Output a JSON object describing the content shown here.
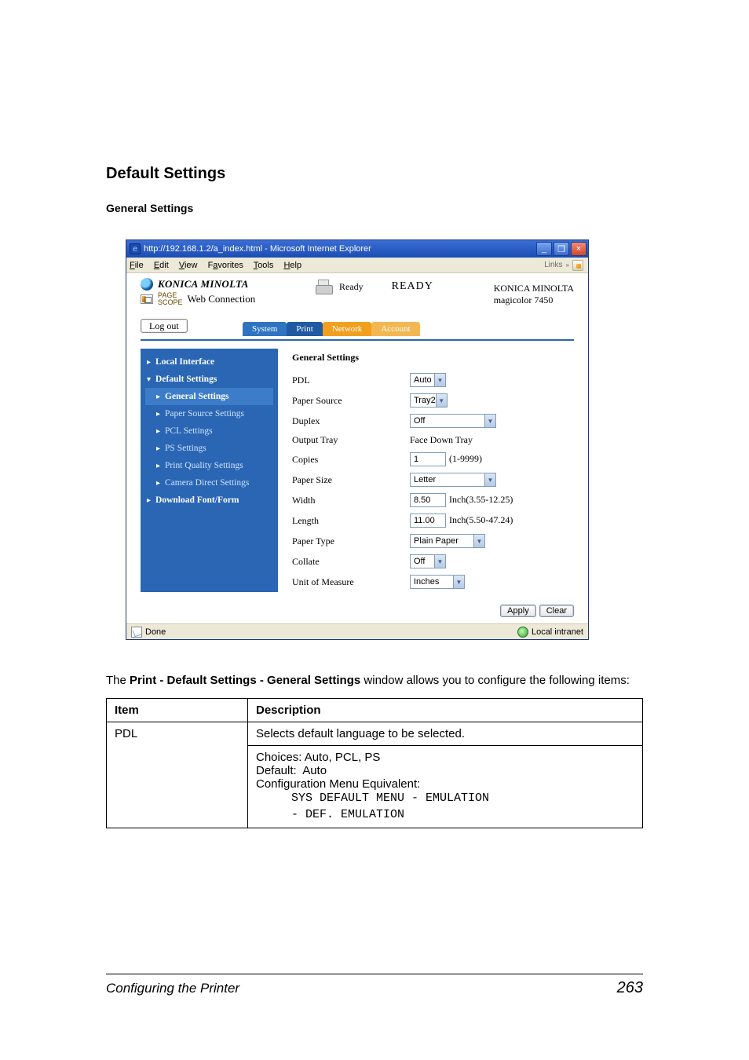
{
  "headings": {
    "h2": "Default Settings",
    "h3": "General Settings"
  },
  "ie": {
    "title": "http://192.168.1.2/a_index.html - Microsoft Internet Explorer",
    "menu": {
      "file": "File",
      "edit": "Edit",
      "view": "View",
      "favorites": "Favorites",
      "tools": "Tools",
      "help": "Help"
    },
    "links_label": "Links",
    "status_done": "Done",
    "status_zone": "Local intranet"
  },
  "app": {
    "brand": "KONICA MINOLTA",
    "pws_small": "PAGE\nSCOPE",
    "pws_main": "Web Connection",
    "ready_small": "Ready",
    "ready_big": "READY",
    "brand_right1": "KONICA MINOLTA",
    "brand_right2": "magicolor 7450",
    "logout": "Log out",
    "tabs": {
      "system": "System",
      "print": "Print",
      "network": "Network",
      "account": "Account"
    }
  },
  "nav": {
    "local_interface": "Local Interface",
    "default_settings": "Default Settings",
    "general_settings": "General Settings",
    "paper_source_settings": "Paper Source Settings",
    "pcl_settings": "PCL Settings",
    "ps_settings": "PS Settings",
    "print_quality_settings": "Print Quality Settings",
    "camera_direct_settings": "Camera Direct Settings",
    "download_font_form": "Download Font/Form"
  },
  "pane": {
    "title": "General Settings",
    "rows": {
      "pdl": {
        "label": "PDL",
        "value": "Auto"
      },
      "source": {
        "label": "Paper Source",
        "value": "Tray2"
      },
      "duplex": {
        "label": "Duplex",
        "value": "Off"
      },
      "out_tray": {
        "label": "Output Tray",
        "value": "Face Down Tray"
      },
      "copies": {
        "label": "Copies",
        "value": "1",
        "hint": "(1-9999)"
      },
      "psize": {
        "label": "Paper Size",
        "value": "Letter"
      },
      "width": {
        "label": "Width",
        "value": "8.50",
        "hint": "Inch(3.55-12.25)"
      },
      "length": {
        "label": "Length",
        "value": "11.00",
        "hint": "Inch(5.50-47.24)"
      },
      "ptype": {
        "label": "Paper Type",
        "value": "Plain Paper"
      },
      "collate": {
        "label": "Collate",
        "value": "Off"
      },
      "unit": {
        "label": "Unit of Measure",
        "value": "Inches"
      }
    },
    "buttons": {
      "apply": "Apply",
      "clear": "Clear"
    }
  },
  "body": {
    "para_pre": "The ",
    "para_bold": "Print - Default Settings - General Settings",
    "para_post": " window allows you to configure the following items:"
  },
  "table": {
    "h_item": "Item",
    "h_desc": "Description",
    "row": {
      "item": "PDL",
      "line1": "Selects default language to be selected.",
      "choices": "Choices: Auto, PCL, PS",
      "default": "Default:  Auto",
      "cfg": "Configuration Menu Equivalent:",
      "mono": "     SYS DEFAULT MENU - EMULATION\n     - DEF. EMULATION"
    }
  },
  "footer": {
    "title": "Configuring the Printer",
    "page": "263"
  }
}
